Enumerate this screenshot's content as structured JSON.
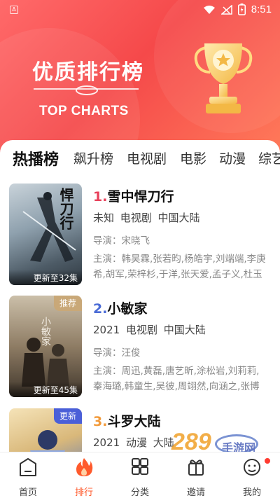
{
  "status": {
    "time": "8:51",
    "app_indicator": "A"
  },
  "header": {
    "title": "优质排行榜",
    "subtitle": "TOP CHARTS"
  },
  "tabs": [
    {
      "label": "热播榜",
      "active": true
    },
    {
      "label": "飙升榜",
      "active": false
    },
    {
      "label": "电视剧",
      "active": false
    },
    {
      "label": "电影",
      "active": false
    },
    {
      "label": "动漫",
      "active": false
    },
    {
      "label": "综艺",
      "active": false
    }
  ],
  "items": [
    {
      "rank": "1.",
      "title": "雪中悍刀行",
      "meta": "未知 电视剧 中国大陆",
      "director": "导演：宋晓飞",
      "cast": "主演：韩昊霖,张若昀,杨皓宇,刘端端,李庚希,胡军,荣梓杉,于洋,张天爱,孟子义,杜玉明",
      "caption": "更新至32集",
      "badge": "",
      "poster_text": "悍刀行"
    },
    {
      "rank": "2.",
      "title": "小敏家",
      "meta": "2021 电视剧 中国大陆",
      "director": "导演：汪俊",
      "cast": "主演：周迅,黄磊,唐艺昕,涂松岩,刘莉莉,秦海璐,韩童生,吴彼,周翊然,向涵之,张博鑫",
      "caption": "更新至45集",
      "badge": "推荐",
      "poster_text": "小敏家"
    },
    {
      "rank": "3.",
      "title": "斗罗大陆",
      "meta": "2021 动漫 大陆",
      "director": "",
      "cast": "",
      "caption": "",
      "badge": "更新",
      "poster_text": ""
    }
  ],
  "nav": [
    {
      "label": "首页",
      "icon": "home-icon"
    },
    {
      "label": "排行",
      "icon": "flame-icon",
      "active": true
    },
    {
      "label": "分类",
      "icon": "grid-icon"
    },
    {
      "label": "邀请",
      "icon": "invite-icon"
    },
    {
      "label": "我的",
      "icon": "profile-icon"
    }
  ],
  "watermark": {
    "text": "手游网",
    "number": "289"
  },
  "colors": {
    "accent": "#f5494a",
    "rank_red": "#e8415b",
    "rank_blue": "#4a6bd6",
    "nav_active": "#ff5a2c"
  }
}
